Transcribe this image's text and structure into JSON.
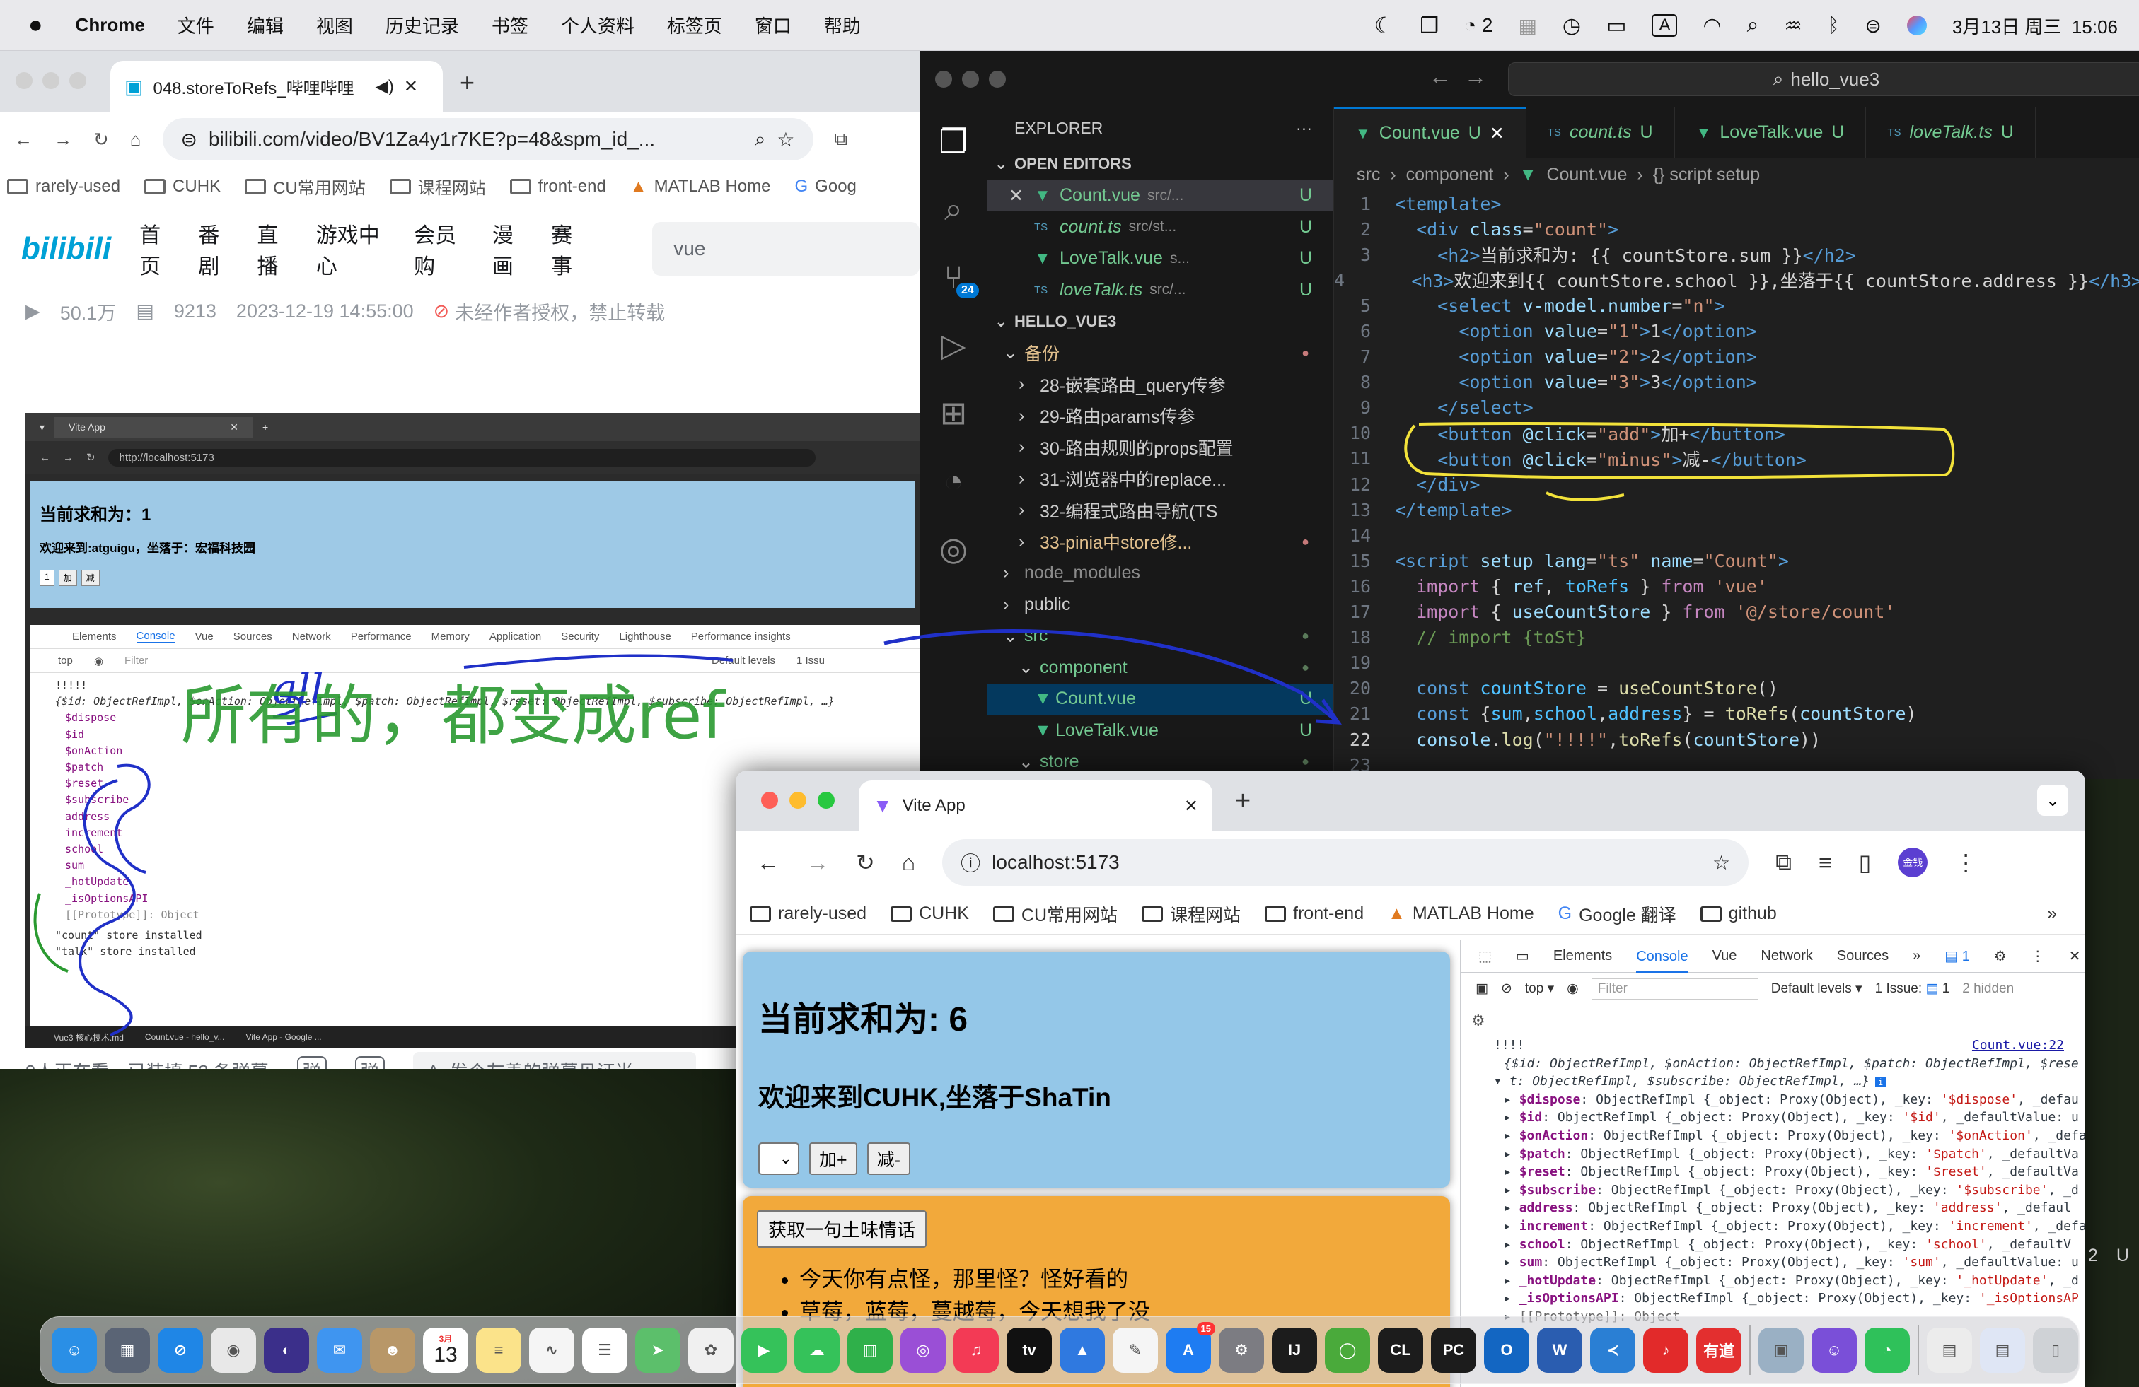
{
  "menubar": {
    "app_name": "Chrome",
    "items": [
      "文件",
      "编辑",
      "视图",
      "历史记录",
      "书签",
      "个人资料",
      "标签页",
      "窗口",
      "帮助"
    ],
    "wechat_count": "2",
    "date_time": "3月13日 周三  15:06",
    "input_source": "A"
  },
  "bili_window": {
    "tab_title": "048.storeToRefs_哔哩哔哩",
    "url": "bilibili.com/video/BV1Za4y1r7KE?p=48&spm_id_...",
    "bookmarks": [
      "rarely-used",
      "CUHK",
      "CU常用网站",
      "课程网站",
      "front-end",
      "MATLAB Home",
      "Goog"
    ],
    "logo": "bilibili",
    "nav": [
      "首页",
      "番剧",
      "直播",
      "游戏中心",
      "会员购",
      "漫画",
      "赛事"
    ],
    "search_value": "vue",
    "stats": {
      "views": "50.1万",
      "danmaku": "9213",
      "date": "2023-12-19 14:55:00",
      "copyright": "未经作者授权，禁止转载"
    },
    "bottom": {
      "watching": "9人正在看，已装填 52 条弹幕",
      "danmaku_placeholder": "发个友善的弹幕见证当"
    }
  },
  "video": {
    "tab": "Vite App",
    "url": "http://localhost:5173",
    "sum_text": "当前求和为：1",
    "welcome_text": "欢迎来到:atguigu，坐落于：宏福科技园",
    "select_val": "1",
    "btn_add": "加",
    "btn_minus": "减",
    "dev_tabs": [
      "Elements",
      "Console",
      "Vue",
      "Sources",
      "Network",
      "Performance",
      "Memory",
      "Application",
      "Security",
      "Lighthouse",
      "Performance insights"
    ],
    "filter_placeholder": "Filter",
    "top": "top",
    "levels": "Default levels",
    "issue": "1 Issu",
    "log_header": "!!!!!",
    "log_obj": "{$id: ObjectRefImpl, $onAction: ObjectRefImpl, $patch: ObjectRefImpl, $reset: ObjectRefImpl, $subscribe: ObjectRefImpl, …}",
    "log_keys": [
      "$dispose",
      "$id",
      "$onAction",
      "$patch",
      "$reset",
      "$subscribe",
      "address",
      "increment",
      "school",
      "sum",
      "_hotUpdate",
      "_isOptionsAPI"
    ],
    "proto": "[[Prototype]]: Object",
    "log_installed1": "\"count\" store installed",
    "log_installed2": "\"talk\" store installed",
    "annotation_top": "all",
    "annotation_main": "所有的，都变成ref",
    "taskbar": [
      "Vue3 核心技术.md",
      "Count.vue - hello_v...",
      "Vite App - Google ..."
    ]
  },
  "vscode": {
    "search": "hello_vue3",
    "explorer_title": "EXPLORER",
    "open_editors": "OPEN EDITORS",
    "open_files": [
      {
        "name": "Count.vue",
        "path": "src/...",
        "status": "U",
        "kind": "vue"
      },
      {
        "name": "count.ts",
        "path": "src/st...",
        "status": "U",
        "kind": "ts"
      },
      {
        "name": "LoveTalk.vue",
        "path": "s...",
        "status": "U",
        "kind": "vue"
      },
      {
        "name": "loveTalk.ts",
        "path": "src/...",
        "status": "U",
        "kind": "ts"
      }
    ],
    "project": "HELLO_VUE3",
    "tree": [
      {
        "label": "备份",
        "depth": 1,
        "open": true,
        "color": "#e2c08d",
        "dot": true
      },
      {
        "label": "28-嵌套路由_query传参",
        "depth": 2,
        "color": "#ccc"
      },
      {
        "label": "29-路由params传参",
        "depth": 2,
        "color": "#ccc"
      },
      {
        "label": "30-路由规则的props配置",
        "depth": 2,
        "color": "#ccc"
      },
      {
        "label": "31-浏览器中的replace...",
        "depth": 2,
        "color": "#ccc"
      },
      {
        "label": "32-编程式路由导航(TS",
        "depth": 2,
        "color": "#ccc"
      },
      {
        "label": "33-pinia中store修...",
        "depth": 2,
        "color": "#e2c08d",
        "dot": true
      },
      {
        "label": "node_modules",
        "depth": 1,
        "color": "#8b8b8b"
      },
      {
        "label": "public",
        "depth": 1,
        "color": "#ccc"
      },
      {
        "label": "src",
        "depth": 1,
        "open": true,
        "color": "#73c991",
        "dot": true
      },
      {
        "label": "component",
        "depth": 2,
        "open": true,
        "color": "#73c991",
        "dot": true
      },
      {
        "label": "Count.vue",
        "depth": 3,
        "color": "#73c991",
        "status": "U",
        "selected": true
      },
      {
        "label": "LoveTalk.vue",
        "depth": 3,
        "color": "#73c991",
        "status": "U"
      },
      {
        "label": "store",
        "depth": 2,
        "open": true,
        "color": "#73c991",
        "dot": true
      }
    ],
    "tabs": [
      {
        "name": "Count.vue",
        "status": "U",
        "active": true,
        "kind": "vue"
      },
      {
        "name": "count.ts",
        "status": "U",
        "kind": "ts"
      },
      {
        "name": "LoveTalk.vue",
        "status": "U",
        "kind": "vue"
      },
      {
        "name": "loveTalk.ts",
        "status": "U",
        "kind": "ts"
      }
    ],
    "breadcrumb": [
      "src",
      "component",
      "Count.vue",
      "{} script setup"
    ],
    "current_line": 22,
    "code": [
      [
        [
          "t",
          "<template>"
        ]
      ],
      [
        [
          "x",
          "  "
        ],
        [
          "t",
          "<div "
        ],
        [
          "a",
          "class"
        ],
        [
          "x",
          "="
        ],
        [
          "s",
          "\"count\""
        ],
        [
          "t",
          ">"
        ]
      ],
      [
        [
          "x",
          "    "
        ],
        [
          "t",
          "<h2>"
        ],
        [
          "x",
          "当前求和为: {{ countStore.sum }}"
        ],
        [
          "t",
          "</h2>"
        ]
      ],
      [
        [
          "x",
          "    "
        ],
        [
          "t",
          "<h3>"
        ],
        [
          "x",
          "欢迎来到{{ countStore.school }},坐落于{{ countStore.address }}"
        ],
        [
          "t",
          "</h3>"
        ]
      ],
      [
        [
          "x",
          "    "
        ],
        [
          "t",
          "<select "
        ],
        [
          "a",
          "v-model.number"
        ],
        [
          "x",
          "="
        ],
        [
          "s",
          "\"n\""
        ],
        [
          "t",
          ">"
        ]
      ],
      [
        [
          "x",
          "      "
        ],
        [
          "t",
          "<option "
        ],
        [
          "a",
          "value"
        ],
        [
          "x",
          "="
        ],
        [
          "s",
          "\"1\""
        ],
        [
          "t",
          ">"
        ],
        [
          "x",
          "1"
        ],
        [
          "t",
          "</option>"
        ]
      ],
      [
        [
          "x",
          "      "
        ],
        [
          "t",
          "<option "
        ],
        [
          "a",
          "value"
        ],
        [
          "x",
          "="
        ],
        [
          "s",
          "\"2\""
        ],
        [
          "t",
          ">"
        ],
        [
          "x",
          "2"
        ],
        [
          "t",
          "</option>"
        ]
      ],
      [
        [
          "x",
          "      "
        ],
        [
          "t",
          "<option "
        ],
        [
          "a",
          "value"
        ],
        [
          "x",
          "="
        ],
        [
          "s",
          "\"3\""
        ],
        [
          "t",
          ">"
        ],
        [
          "x",
          "3"
        ],
        [
          "t",
          "</option>"
        ]
      ],
      [
        [
          "x",
          "    "
        ],
        [
          "t",
          "</select>"
        ]
      ],
      [
        [
          "x",
          "    "
        ],
        [
          "t",
          "<button "
        ],
        [
          "a",
          "@click"
        ],
        [
          "x",
          "="
        ],
        [
          "s",
          "\"add\""
        ],
        [
          "t",
          ">"
        ],
        [
          "x",
          "加+"
        ],
        [
          "t",
          "</button>"
        ]
      ],
      [
        [
          "x",
          "    "
        ],
        [
          "t",
          "<button "
        ],
        [
          "a",
          "@click"
        ],
        [
          "x",
          "="
        ],
        [
          "s",
          "\"minus\""
        ],
        [
          "t",
          ">"
        ],
        [
          "x",
          "减-"
        ],
        [
          "t",
          "</button>"
        ]
      ],
      [
        [
          "x",
          "  "
        ],
        [
          "t",
          "</div>"
        ]
      ],
      [
        [
          "t",
          "</template>"
        ]
      ],
      [
        [
          "x",
          ""
        ]
      ],
      [
        [
          "t",
          "<script "
        ],
        [
          "a",
          "setup "
        ],
        [
          "a",
          "lang"
        ],
        [
          "x",
          "="
        ],
        [
          "s",
          "\"ts\" "
        ],
        [
          "a",
          "name"
        ],
        [
          "x",
          "="
        ],
        [
          "s",
          "\"Count\""
        ],
        [
          "t",
          ">"
        ]
      ],
      [
        [
          "x",
          "  "
        ],
        [
          "k",
          "import"
        ],
        [
          "x",
          " { "
        ],
        [
          "a",
          "ref"
        ],
        [
          "x",
          ", "
        ],
        [
          "v",
          "toRefs"
        ],
        [
          "x",
          " } "
        ],
        [
          "k",
          "from"
        ],
        [
          "s",
          " 'vue'"
        ]
      ],
      [
        [
          "x",
          "  "
        ],
        [
          "k",
          "import"
        ],
        [
          "x",
          " { "
        ],
        [
          "a",
          "useCountStore"
        ],
        [
          "x",
          " } "
        ],
        [
          "k",
          "from"
        ],
        [
          "s",
          " '@/store/count'"
        ]
      ],
      [
        [
          "c",
          "  // import {toSt}"
        ]
      ],
      [
        [
          "x",
          ""
        ]
      ],
      [
        [
          "x",
          "  "
        ],
        [
          "b",
          "const "
        ],
        [
          "v",
          "countStore"
        ],
        [
          "x",
          " = "
        ],
        [
          "f",
          "useCountStore"
        ],
        [
          "x",
          "()"
        ]
      ],
      [
        [
          "x",
          "  "
        ],
        [
          "b",
          "const "
        ],
        [
          "x",
          "{"
        ],
        [
          "v",
          "sum"
        ],
        [
          "x",
          ","
        ],
        [
          "v",
          "school"
        ],
        [
          "x",
          ","
        ],
        [
          "v",
          "address"
        ],
        [
          "x",
          "} = "
        ],
        [
          "f",
          "toRefs"
        ],
        [
          "x",
          "("
        ],
        [
          "a",
          "countStore"
        ],
        [
          "x",
          ")"
        ]
      ],
      [
        [
          "x",
          "  "
        ],
        [
          "a",
          "console"
        ],
        [
          "x",
          "."
        ],
        [
          "f",
          "log"
        ],
        [
          "x",
          "("
        ],
        [
          "s",
          "\"!!!!\""
        ],
        [
          "x",
          ","
        ],
        [
          "f",
          "toRefs"
        ],
        [
          "x",
          "("
        ],
        [
          "a",
          "countStore"
        ],
        [
          "x",
          "))"
        ]
      ],
      [
        [
          "x",
          ""
        ]
      ]
    ]
  },
  "vite": {
    "tab": "Vite App",
    "url": "localhost:5173",
    "bookmarks": [
      "rarely-used",
      "CUHK",
      "CU常用网站",
      "课程网站",
      "front-end",
      "MATLAB Home",
      "Google 翻译",
      "github"
    ],
    "profile": "金钱",
    "sum_title": "当前求和为: 6",
    "welcome": "欢迎来到CUHK,坐落于ShaTin",
    "btn_add": "加+",
    "btn_minus": "减-",
    "talk_button": "获取一句土味情话",
    "talks": [
      "今天你有点怪，那里怪？怪好看的",
      "草莓，蓝莓，蔓越莓，今天想我了没"
    ],
    "devtools": {
      "tabs": [
        "Elements",
        "Console",
        "Vue",
        "Network",
        "Sources"
      ],
      "issues_badge": "1",
      "top": "top",
      "filter": "Filter",
      "levels": "Default levels",
      "issue_text": "1 Issue:",
      "issue_count": "1",
      "hidden": "2 hidden",
      "source_link": "Count.vue:22",
      "log_label": "!!!!",
      "obj_line1": "{$id: ObjectRefImpl, $onAction: ObjectRefImpl, $patch: ObjectRefImpl, $rese",
      "obj_line2": "t: ObjectRefImpl, $subscribe: ObjectRefImpl, …}",
      "entries": [
        {
          "k": "$dispose",
          "v": "'$dispose'",
          "tail": ", _defau"
        },
        {
          "k": "$id",
          "v": "'$id'",
          "tail": ", _defaultValue: u"
        },
        {
          "k": "$onAction",
          "v": "'$onAction'",
          "tail": ", _defa"
        },
        {
          "k": "$patch",
          "v": "'$patch'",
          "tail": ", _defaultVa"
        },
        {
          "k": "$reset",
          "v": "'$reset'",
          "tail": ", _defaultVa"
        },
        {
          "k": "$subscribe",
          "v": "'$subscribe'",
          "tail": ", _d"
        },
        {
          "k": "address",
          "v": "'address'",
          "tail": ", _defaul"
        },
        {
          "k": "increment",
          "v": "'increment'",
          "tail": ", _defa"
        },
        {
          "k": "school",
          "v": "'school'",
          "tail": ", _defaultV"
        },
        {
          "k": "sum",
          "v": "'sum'",
          "tail": ", _defaultValue: u"
        },
        {
          "k": "_hotUpdate",
          "v": "'_hotUpdate'",
          "tail": ", _d"
        },
        {
          "k": "_isOptionsAPI",
          "v": "'_isOptionsAP",
          "tail": ""
        }
      ],
      "proto": "[[Prototype]]: Object",
      "gutter_num": "2",
      "gutter_u": "U"
    }
  },
  "dock": {
    "calendar_month": "3月",
    "calendar_day": "13",
    "appstore_badge": "15",
    "apps": [
      {
        "name": "finder",
        "color": "#2a8fe6",
        "glyph": "☺"
      },
      {
        "name": "launchpad",
        "color": "#5a6475",
        "glyph": "▦"
      },
      {
        "name": "safari",
        "color": "#1f86e6",
        "glyph": "⊘"
      },
      {
        "name": "chrome",
        "color": "#e8e8e8",
        "glyph": "◉"
      },
      {
        "name": "siri",
        "color": "#3b2f8a",
        "glyph": "◐"
      },
      {
        "name": "mail",
        "color": "#3f95f0",
        "glyph": "✉"
      },
      {
        "name": "contacts",
        "color": "#b89768",
        "glyph": "☻"
      },
      {
        "name": "calendar",
        "color": "#ffffff",
        "glyph": ""
      },
      {
        "name": "notes",
        "color": "#fbe38a",
        "glyph": "≡"
      },
      {
        "name": "freeform",
        "color": "#f5f5f5",
        "glyph": "∿"
      },
      {
        "name": "reminders",
        "color": "#ffffff",
        "glyph": "☰"
      },
      {
        "name": "maps",
        "color": "#5cbf6b",
        "glyph": "➤"
      },
      {
        "name": "photos",
        "color": "#f0f0f0",
        "glyph": "✿"
      },
      {
        "name": "facetime",
        "color": "#35c25a",
        "glyph": "▶"
      },
      {
        "name": "messages",
        "color": "#35c25a",
        "glyph": "☁"
      },
      {
        "name": "numbers",
        "color": "#2fb04a",
        "glyph": "▥"
      },
      {
        "name": "podcasts",
        "color": "#9a4fd6",
        "glyph": "◎"
      },
      {
        "name": "music",
        "color": "#f33a55",
        "glyph": "♫"
      },
      {
        "name": "appletv",
        "color": "#111111",
        "glyph": "tv"
      },
      {
        "name": "keynote",
        "color": "#2f79e0",
        "glyph": "▲"
      },
      {
        "name": "pages",
        "color": "#f5f5f5",
        "glyph": "✎"
      },
      {
        "name": "appstore",
        "color": "#1e7cf2",
        "glyph": "A"
      },
      {
        "name": "system-settings",
        "color": "#7c7c82",
        "glyph": "⚙"
      },
      {
        "name": "intellij",
        "color": "#1c1c1c",
        "glyph": "IJ"
      },
      {
        "name": "anaconda",
        "color": "#4aaa3b",
        "glyph": "◯"
      },
      {
        "name": "clion",
        "color": "#1c1c1c",
        "glyph": "CL"
      },
      {
        "name": "pycharm",
        "color": "#1c1c1c",
        "glyph": "PC"
      },
      {
        "name": "outlook",
        "color": "#1366c2",
        "glyph": "O"
      },
      {
        "name": "word",
        "color": "#2a5db0",
        "glyph": "W"
      },
      {
        "name": "vscode",
        "color": "#2a7fd4",
        "glyph": "≺"
      },
      {
        "name": "netease-music",
        "color": "#e22a2a",
        "glyph": "♪"
      },
      {
        "name": "youdao",
        "color": "#e32f2f",
        "glyph": "有道"
      },
      {
        "name": "preview",
        "color": "#9ab0c4",
        "glyph": "▣"
      },
      {
        "name": "qq-game",
        "color": "#7a4fd8",
        "glyph": "☺"
      },
      {
        "name": "wechat",
        "color": "#2fc15a",
        "glyph": "◔"
      },
      {
        "name": "document-1",
        "color": "#ececec",
        "glyph": "▤"
      },
      {
        "name": "document-2",
        "color": "#dfe6f5",
        "glyph": "▤"
      },
      {
        "name": "trash",
        "color": "#cfd2d6",
        "glyph": "▯"
      }
    ]
  }
}
